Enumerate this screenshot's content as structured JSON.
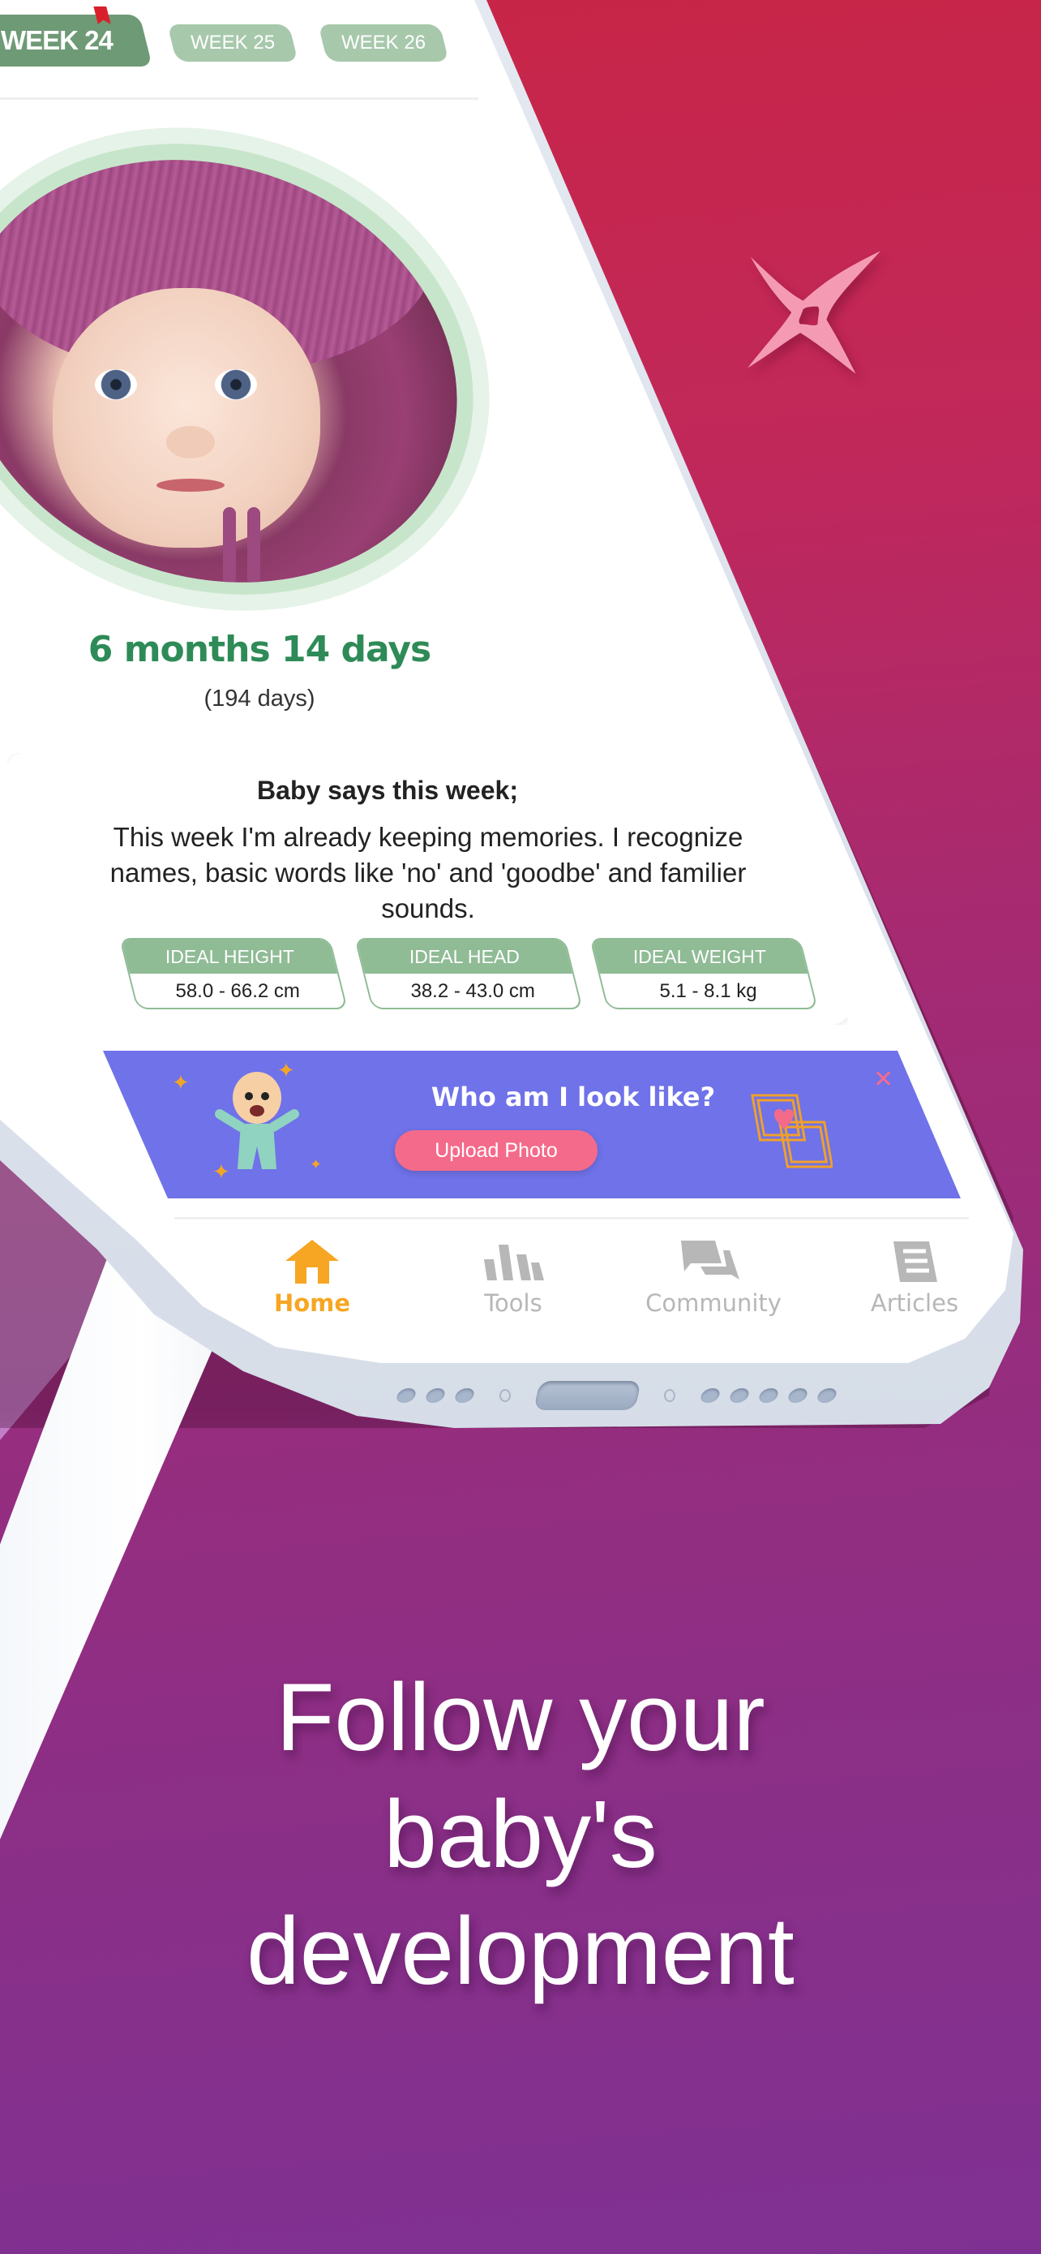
{
  "colors": {
    "active_tab": "#6e9a76",
    "inactive_tab": "#a7c8ab",
    "age_text": "#2e8b57",
    "banner_bg": "#6f72e8",
    "upload_button": "#f46a8a",
    "nav_active": "#f6a623",
    "nav_inactive": "#b7b7b7"
  },
  "week_tabs": [
    {
      "label": "WEEK 24",
      "active": true
    },
    {
      "label": "WEEK 25",
      "active": false
    },
    {
      "label": "WEEK 26",
      "active": false
    }
  ],
  "age": {
    "main": "6 months 14 days",
    "total_days": "(194 days)"
  },
  "baby_says": {
    "title": "Baby says this week;",
    "text": "This week I'm already keeping memories. I recognize names, basic words like 'no' and 'goodbe' and familier sounds.",
    "metrics": [
      {
        "label": "IDEAL HEIGHT",
        "value": "58.0 - 66.2 cm"
      },
      {
        "label": "IDEAL HEAD",
        "value": "38.2 - 43.0 cm"
      },
      {
        "label": "IDEAL WEIGHT",
        "value": "5.1 - 8.1 kg"
      }
    ]
  },
  "banner": {
    "title": "Who am I look like?",
    "button_label": "Upload Photo",
    "close_glyph": "✕"
  },
  "bottom_nav": [
    {
      "label": "Home",
      "icon": "home-icon",
      "active": true
    },
    {
      "label": "Tools",
      "icon": "bar-chart-icon",
      "active": false
    },
    {
      "label": "Community",
      "icon": "chat-bubbles-icon",
      "active": false
    },
    {
      "label": "Articles",
      "icon": "document-icon",
      "active": false
    }
  ],
  "headline": {
    "line1": "Follow your",
    "line2": "baby's",
    "line3": "development"
  }
}
